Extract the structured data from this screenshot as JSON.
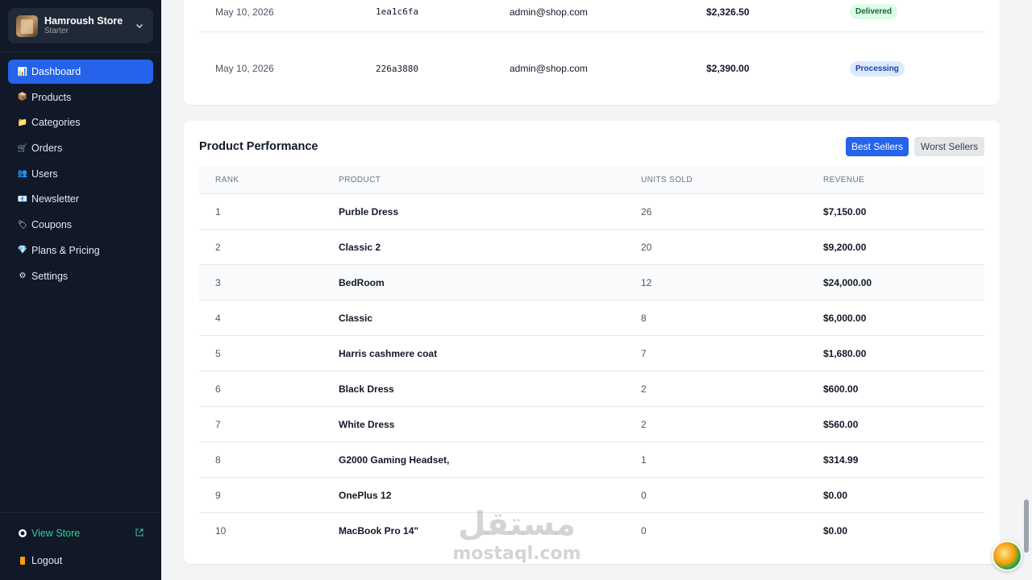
{
  "store": {
    "name": "Hamroush Store",
    "plan": "Starter"
  },
  "nav": [
    {
      "label": "Dashboard",
      "icon": "chart-icon",
      "glyph": "📊",
      "active": true
    },
    {
      "label": "Products",
      "icon": "box-icon",
      "glyph": "📦"
    },
    {
      "label": "Categories",
      "icon": "folder-icon",
      "glyph": "📁"
    },
    {
      "label": "Orders",
      "icon": "cart-icon",
      "glyph": "🛒"
    },
    {
      "label": "Users",
      "icon": "users-icon",
      "glyph": "👥"
    },
    {
      "label": "Newsletter",
      "icon": "mail-icon",
      "glyph": "📧"
    },
    {
      "label": "Coupons",
      "icon": "tag-icon",
      "glyph": "🏷"
    },
    {
      "label": "Plans & Pricing",
      "icon": "diamond-icon",
      "glyph": "💎"
    },
    {
      "label": "Settings",
      "icon": "gear-icon",
      "glyph": "⚙"
    }
  ],
  "footer": {
    "view_store": "View Store",
    "logout": "Logout"
  },
  "recent_orders": [
    {
      "date": "May 10, 2026",
      "id": "1ea1c6fa",
      "email": "admin@shop.com",
      "amount": "$2,326.50",
      "status": "Delivered"
    },
    {
      "date": "May 10, 2026",
      "id": "226a3880",
      "email": "admin@shop.com",
      "amount": "$2,390.00",
      "status": "Processing"
    }
  ],
  "performance": {
    "title": "Product Performance",
    "best_label": "Best Sellers",
    "worst_label": "Worst Sellers",
    "headers": {
      "rank": "RANK",
      "product": "PRODUCT",
      "units": "UNITS SOLD",
      "revenue": "REVENUE"
    },
    "rows": [
      {
        "rank": "1",
        "product": "Purble Dress",
        "units": "26",
        "revenue": "$7,150.00"
      },
      {
        "rank": "2",
        "product": "Classic 2",
        "units": "20",
        "revenue": "$9,200.00"
      },
      {
        "rank": "3",
        "product": "BedRoom",
        "units": "12",
        "revenue": "$24,000.00"
      },
      {
        "rank": "4",
        "product": "Classic",
        "units": "8",
        "revenue": "$6,000.00"
      },
      {
        "rank": "5",
        "product": "Harris cashmere coat",
        "units": "7",
        "revenue": "$1,680.00"
      },
      {
        "rank": "6",
        "product": "Black Dress",
        "units": "2",
        "revenue": "$600.00"
      },
      {
        "rank": "7",
        "product": "White Dress",
        "units": "2",
        "revenue": "$560.00"
      },
      {
        "rank": "8",
        "product": "G2000 Gaming Headset,",
        "units": "1",
        "revenue": "$314.99"
      },
      {
        "rank": "9",
        "product": "OnePlus 12",
        "units": "0",
        "revenue": "$0.00"
      },
      {
        "rank": "10",
        "product": "MacBook Pro 14\"",
        "units": "0",
        "revenue": "$0.00"
      }
    ]
  },
  "watermark": {
    "arabic": "مستقل",
    "latin": "mostaql.com"
  },
  "colors": {
    "accent": "#2563eb",
    "sidebar_bg": "#111827",
    "view_store": "#34d399"
  }
}
